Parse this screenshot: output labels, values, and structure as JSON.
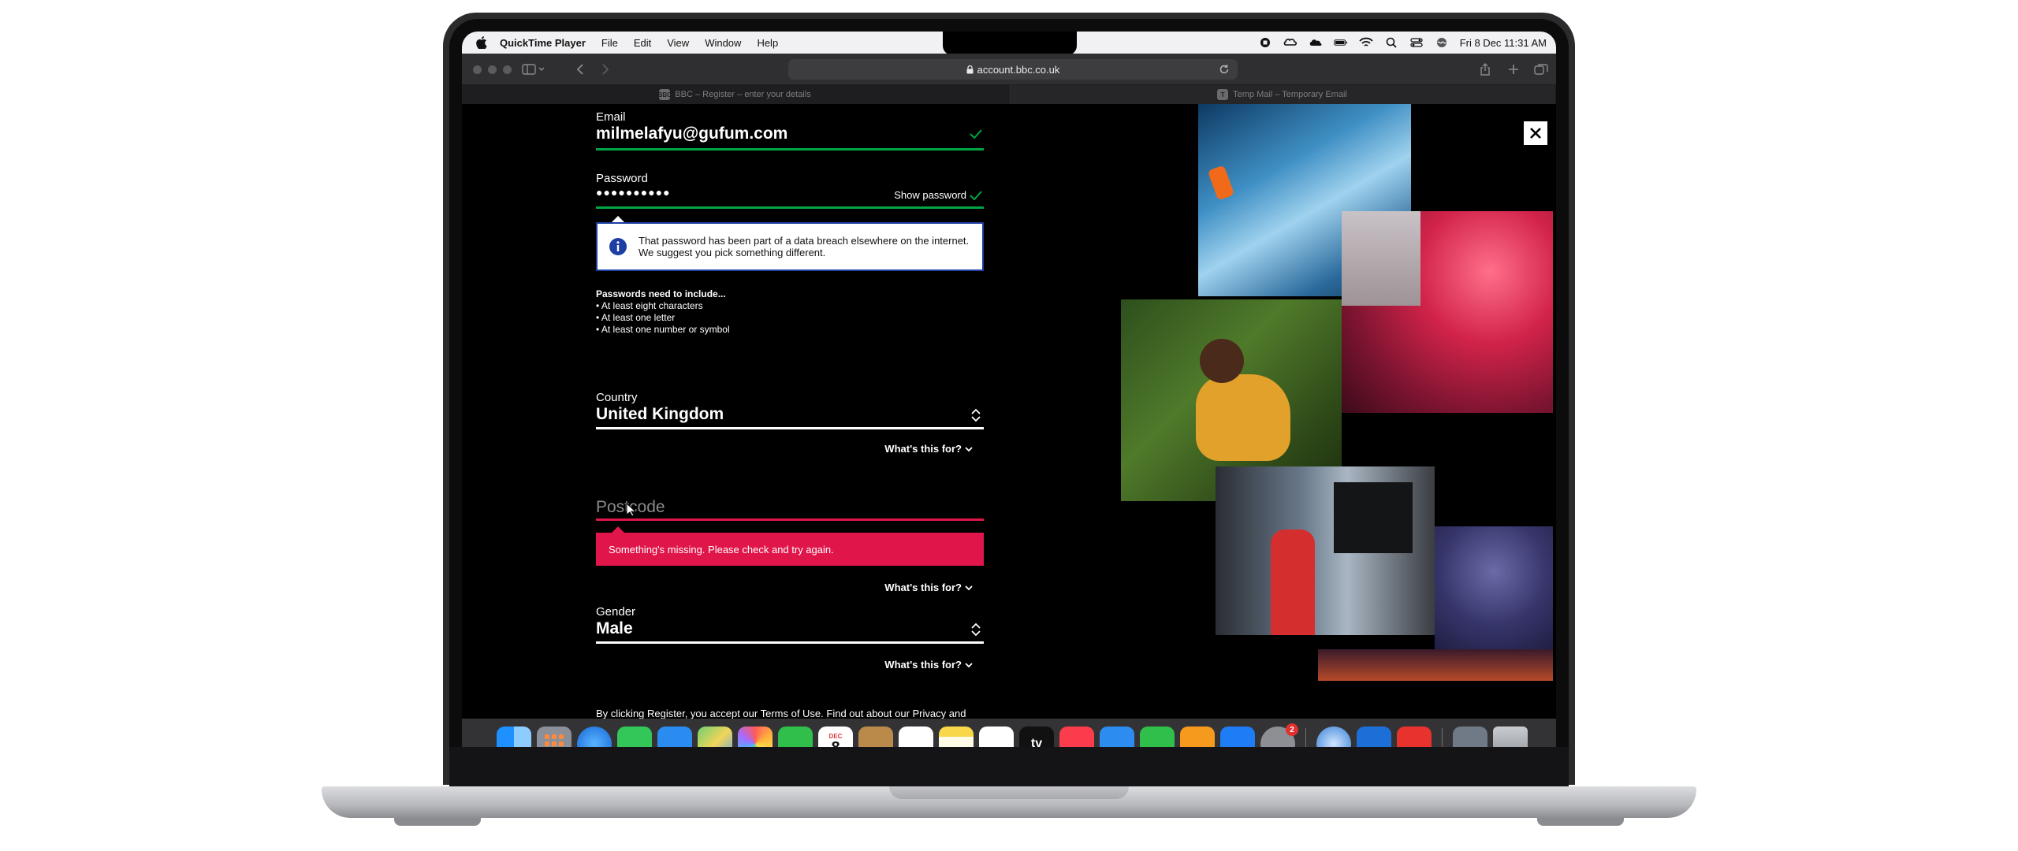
{
  "menubar": {
    "app_name": "QuickTime Player",
    "menus": [
      "File",
      "Edit",
      "View",
      "Window",
      "Help"
    ],
    "clock": "Fri 8 Dec  11:31 AM"
  },
  "browser": {
    "url": "account.bbc.co.uk",
    "tabs": [
      {
        "favicon": "BBC",
        "title": "BBC – Register – enter your details"
      },
      {
        "favicon": "T",
        "title": "Temp Mail – Temporary Email"
      }
    ]
  },
  "form": {
    "email": {
      "label": "Email",
      "value": "milmelafyu@gufum.com"
    },
    "password": {
      "label": "Password",
      "value": "●●●●●●●●●●",
      "show_label": "Show password"
    },
    "breach_message": {
      "line1": "That password has been part of a data breach elsewhere on the internet.",
      "line2": "We suggest you pick something different."
    },
    "requirements": {
      "heading": "Passwords need to include...",
      "items": [
        "• At least eight characters",
        "• At least one letter",
        "• At least one number or symbol"
      ]
    },
    "country": {
      "label": "Country",
      "value": "United Kingdom",
      "help": "What's this for?"
    },
    "postcode": {
      "placeholder": "Postcode",
      "error": "Something's missing. Please check and try again.",
      "help": "What's this for?"
    },
    "gender": {
      "label": "Gender",
      "value": "Male",
      "help": "What's this for?"
    },
    "terms": "By clicking Register, you accept our Terms of Use. Find out about our Privacy and"
  },
  "dock": {
    "calendar_month": "DEC",
    "calendar_day": "8",
    "settings_badge": "2",
    "tv_label": "tv"
  },
  "colors": {
    "valid_green": "#00a544",
    "error_red": "#e0154a",
    "info_blue": "#1d3fa3"
  }
}
